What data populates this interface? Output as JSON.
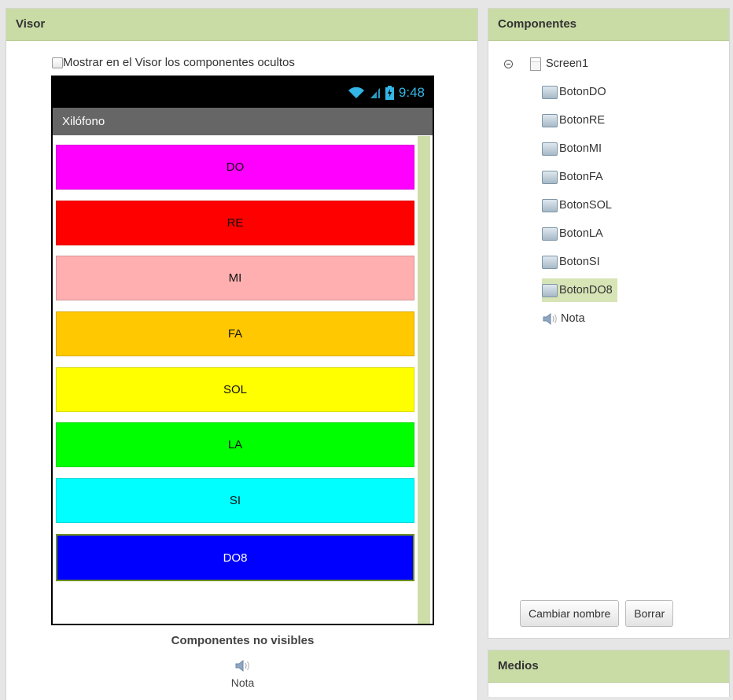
{
  "visor": {
    "title": "Visor",
    "show_hidden_label": "Mostrar en el Visor los componentes ocultos",
    "phone": {
      "time": "9:48",
      "app_title": "Xilófono",
      "buttons": [
        {
          "label": "DO",
          "color": "#ff00ff"
        },
        {
          "label": "RE",
          "color": "#ff0000"
        },
        {
          "label": "MI",
          "color": "#ffafaf"
        },
        {
          "label": "FA",
          "color": "#ffc800"
        },
        {
          "label": "SOL",
          "color": "#ffff00"
        },
        {
          "label": "LA",
          "color": "#00ff00"
        },
        {
          "label": "SI",
          "color": "#00ffff"
        },
        {
          "label": "DO8",
          "color": "#0000ff",
          "text_color": "#ffffff",
          "selected": true
        }
      ]
    },
    "nonvisible_title": "Componentes no visibles",
    "nonvisible_items": [
      {
        "label": "Nota",
        "icon": "speaker-icon"
      }
    ]
  },
  "componentes": {
    "title": "Componentes",
    "root": {
      "label": "Screen1",
      "icon": "screen-icon"
    },
    "children": [
      {
        "label": "BotonDO",
        "icon": "button-icon"
      },
      {
        "label": "BotonRE",
        "icon": "button-icon"
      },
      {
        "label": "BotonMI",
        "icon": "button-icon"
      },
      {
        "label": "BotonFA",
        "icon": "button-icon"
      },
      {
        "label": "BotonSOL",
        "icon": "button-icon"
      },
      {
        "label": "BotonLA",
        "icon": "button-icon"
      },
      {
        "label": "BotonSI",
        "icon": "button-icon"
      },
      {
        "label": "BotonDO8",
        "icon": "button-icon",
        "selected": true
      },
      {
        "label": "Nota",
        "icon": "speaker-icon"
      }
    ],
    "rename_button": "Cambiar nombre",
    "delete_button": "Borrar"
  },
  "medios": {
    "title": "Medios"
  },
  "colors": {
    "header_bg": "#c9dca5",
    "selection_bg": "#d7e4b6",
    "status_accent": "#33b5e5",
    "scrollbar": "#cfdda9"
  }
}
